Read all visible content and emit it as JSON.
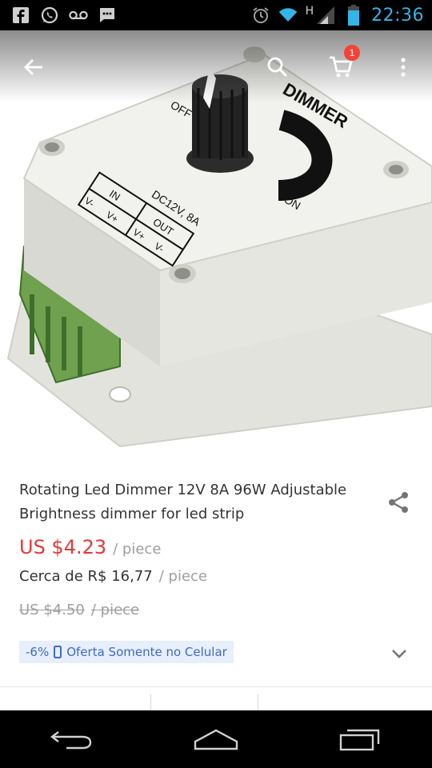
{
  "status_bar": {
    "time": "22:36",
    "network_type": "H",
    "left_icons": [
      "facebook-icon",
      "whatsapp-icon",
      "voicemail-icon",
      "message-icon"
    ],
    "right_icons": [
      "alarm-icon",
      "wifi-icon",
      "signal-icon",
      "battery-icon"
    ],
    "clock_color": "#33b5e5"
  },
  "toolbar": {
    "cart_count": "1"
  },
  "product": {
    "title": "Rotating Led Dimmer 12V 8A 96W Adjustable Brightness dimmer for led strip",
    "image_labels": {
      "dimmer": "DIMMER",
      "off": "OFF",
      "on": "ON",
      "rating": "DC12V, 8A",
      "in": "IN",
      "out": "OUT",
      "pins": [
        "V-",
        "V+",
        "V+",
        "V-"
      ]
    },
    "price": "US $4.23",
    "price_unit": "/ piece",
    "local_price": "Cerca de R$ 16,77",
    "local_unit": "/ piece",
    "original_price": "US $4.50",
    "original_unit": "/ piece",
    "promo_discount": "-6%",
    "promo_text": "Oferta Somente no Celular",
    "price_color": "#e53935",
    "promo_color": "#3f6ac2"
  }
}
